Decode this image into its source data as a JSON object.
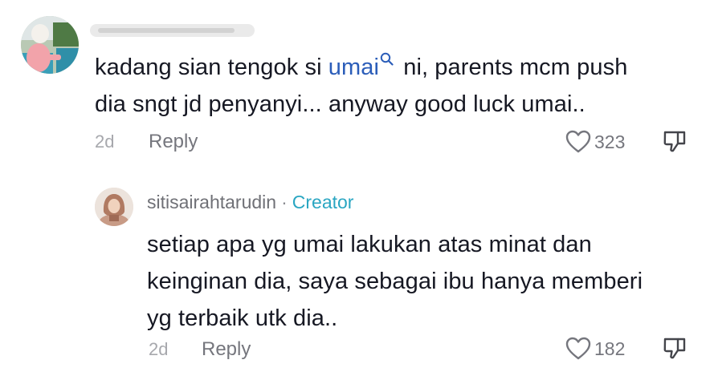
{
  "comment1": {
    "avatar": "user-avatar",
    "username_blurred": true,
    "text_before_mention": "kadang sian tengok si ",
    "mention": "umai",
    "text_after_mention_line1": " ni, parents mcm push",
    "text_line2": "dia sngt jd penyanyi... anyway good luck umai..",
    "time": "2d",
    "reply_label": "Reply",
    "like_count": "323",
    "icons": {
      "like": "heart-icon",
      "dislike": "dislike-icon",
      "mention_search": "search-icon"
    },
    "colors": {
      "mention": "#2b5db9"
    }
  },
  "comment2": {
    "avatar": "creator-avatar",
    "username": "sitisairahtarudin",
    "separator": "·",
    "badge": "Creator",
    "text_line1": "setiap apa yg umai lakukan atas minat dan",
    "text_line2": "keinginan dia, saya sebagai ibu hanya memberi",
    "text_line3": "yg terbaik utk dia..",
    "time": "2d",
    "reply_label": "Reply",
    "like_count": "182",
    "colors": {
      "badge": "#2aa6c2"
    }
  }
}
